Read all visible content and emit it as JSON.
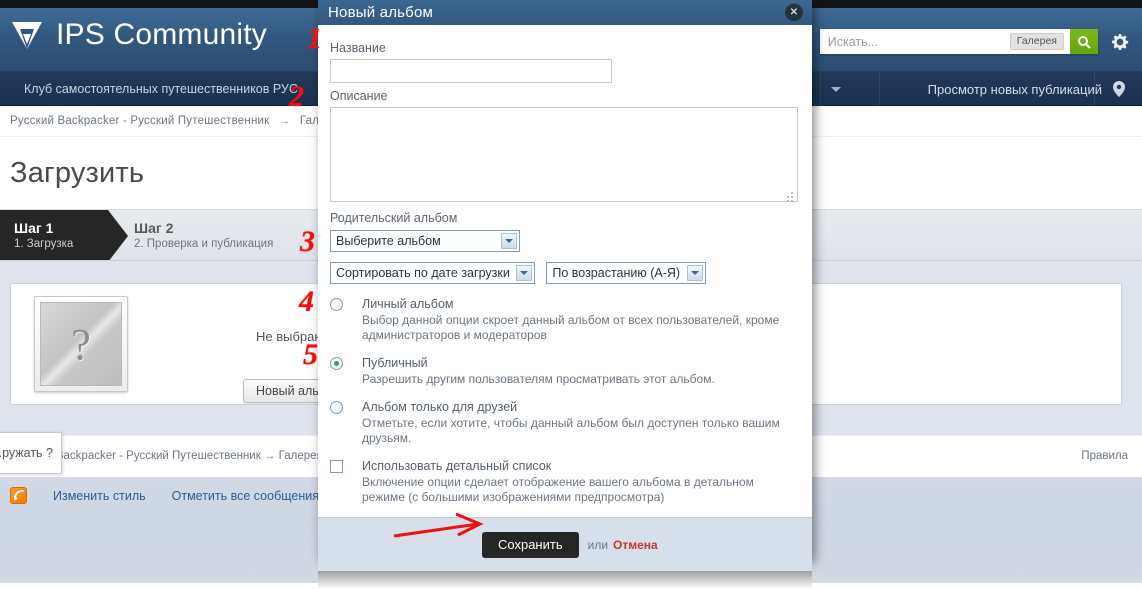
{
  "site": {
    "brand_title": "IPS Community",
    "logo_icon": "ips-logo-icon",
    "search": {
      "placeholder": "Искать...",
      "value": "",
      "scope_label": "Галерея",
      "search_icon": "search-icon",
      "settings_icon": "gear-icon"
    },
    "nav": {
      "primary_label": "Клуб самостоятельных путешественников РУС",
      "caret_icon": "chevron-down-icon",
      "new_posts_label": "Просмотр новых публикаций",
      "location_icon": "map-pin-icon"
    },
    "breadcrumb": {
      "root": "Русский Backpacker - Русский Путешественник",
      "arrow": "→",
      "second": "Галерея"
    },
    "page_title": "Загрузить",
    "steps": [
      {
        "title": "Шаг 1",
        "subtitle": "1. Загрузка",
        "state": "active"
      },
      {
        "title": "Шаг 2",
        "subtitle": "2. Проверка и публикация",
        "state": "inactive"
      }
    ],
    "upload_panel": {
      "thumb_icon": "question-placeholder-icon",
      "thumb_glyph": "?",
      "no_album_text": "Не выбран альбом",
      "new_album_button": "Новый альбом"
    },
    "footer_breadcrumb": {
      "root": "Русский Backpacker - Русский Путешественник",
      "arrow": "→",
      "second": "Галерея"
    },
    "footer_rules": "Правила",
    "tooltip_text": "...ружать ?",
    "bottom_bar": {
      "rss_icon": "rss-icon",
      "links": [
        "Изменить стиль",
        "Отметить все сообщения проч..."
      ]
    }
  },
  "modal": {
    "title": "Новый альбом",
    "close_icon": "close-icon",
    "name_label": "Название",
    "name_value": "",
    "description_label": "Описание",
    "description_value": "",
    "parent_album_label": "Родительский альбом",
    "parent_album_value": "Выберите альбом",
    "sort_by_value": "Сортировать по дате загрузки",
    "sort_order_value": "По возрастанию (А-Я)",
    "dropdown_icon": "chevron-down-icon",
    "options": [
      {
        "type": "radio",
        "checked": false,
        "title": "Личный альбом",
        "desc": "Выбор данной опции скроет данный альбом от всех пользователей, кроме администраторов и модераторов"
      },
      {
        "type": "radio",
        "checked": true,
        "title": "Публичный",
        "desc": "Разрешить другим пользователям просматривать этот альбом."
      },
      {
        "type": "radio",
        "checked": false,
        "title": "Альбом только для друзей",
        "desc": "Отметьте, если хотите, чтобы данный альбом был доступен только вашим друзьям."
      },
      {
        "type": "checkbox",
        "checked": false,
        "title": "Использовать детальный список",
        "desc": "Включение опции сделает отображение вашего альбома в детальном режиме (с большими изображениями предпросмотра)"
      }
    ],
    "save_label": "Сохранить",
    "or_label": "или",
    "cancel_label": "Отмена"
  },
  "annotations": {
    "color": "#ee1111",
    "markers": [
      "1",
      "2",
      "3",
      "4",
      "5"
    ],
    "arrow_icon": "red-arrow-icon"
  }
}
